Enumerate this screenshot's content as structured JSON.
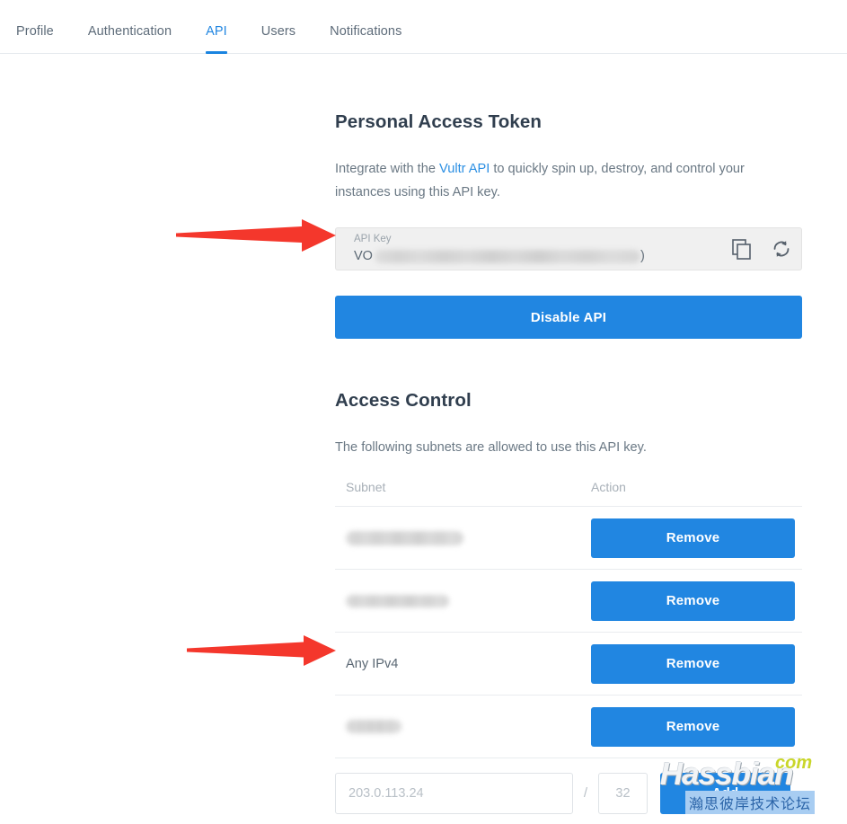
{
  "nav": {
    "tabs": [
      {
        "label": "Profile",
        "active": false
      },
      {
        "label": "Authentication",
        "active": false
      },
      {
        "label": "API",
        "active": true
      },
      {
        "label": "Users",
        "active": false
      },
      {
        "label": "Notifications",
        "active": false
      }
    ]
  },
  "personal_access_token": {
    "title": "Personal Access Token",
    "description_before": "Integrate with the ",
    "description_link": "Vultr API",
    "description_after": " to quickly spin up, destroy, and control your instances using this API key.",
    "api_key_label": "API Key",
    "api_key_value_prefix": "VO",
    "api_key_value_suffix": ")",
    "copy_icon": "copy-icon",
    "refresh_icon": "refresh-icon",
    "disable_button": "Disable API"
  },
  "access_control": {
    "title": "Access Control",
    "description": "The following subnets are allowed to use this API key.",
    "columns": {
      "subnet": "Subnet",
      "action": "Action"
    },
    "rows": [
      {
        "subnet": "",
        "redacted": true,
        "blur_class": "sub-blur-1",
        "action": "Remove"
      },
      {
        "subnet": "",
        "redacted": true,
        "blur_class": "sub-blur-2",
        "action": "Remove"
      },
      {
        "subnet": "Any IPv4",
        "redacted": false,
        "blur_class": "",
        "action": "Remove"
      },
      {
        "subnet": "",
        "redacted": true,
        "blur_class": "sub-blur-3",
        "action": "Remove"
      }
    ],
    "add_form": {
      "ip_placeholder": "203.0.113.24",
      "ip_value": "",
      "separator": "/",
      "cidr_placeholder": "32",
      "cidr_value": "",
      "add_button": "Add"
    }
  },
  "annotations": {
    "arrow_api_key": "red-arrow-right",
    "arrow_any_ipv4": "red-arrow-right",
    "arrow_color": "#f4372c"
  },
  "watermark": {
    "logo": "Hassbian",
    "tld": "com",
    "chinese": "瀚思彼岸技术论坛"
  },
  "colors": {
    "accent_blue": "#2186e1",
    "link_blue": "#2b8fe3",
    "text_dark": "#303e4e",
    "text_muted": "#6a7884",
    "border": "#e9ecef"
  }
}
